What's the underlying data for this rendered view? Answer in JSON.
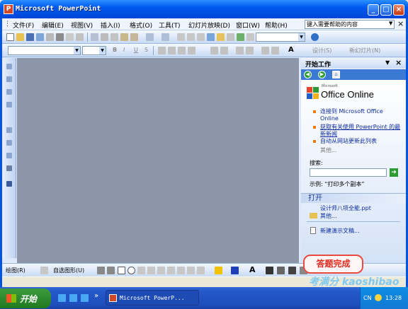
{
  "window": {
    "title": "Microsoft PowerPoint",
    "app_icon": "P",
    "buttons": [
      "minimize",
      "maximize",
      "close"
    ]
  },
  "menu": {
    "items": [
      "文件(F)",
      "编辑(E)",
      "视图(V)",
      "插入(I)",
      "格式(O)",
      "工具(T)",
      "幻灯片放映(D)",
      "窗口(W)",
      "帮助(H)"
    ],
    "help_placeholder": "键入需要帮助的内容",
    "close_doc": "×"
  },
  "format_toolbar": {
    "bold": "B",
    "italic": "I",
    "underline": "U",
    "shadow": "S",
    "font_color": "A",
    "design": "设计(S)",
    "new_slide": "新幻灯片(N)"
  },
  "task_pane": {
    "title": "开始工作",
    "logo_small": "Microsoft",
    "logo_main": "Office Online",
    "links": [
      "连接到 Microsoft Office Online",
      "获取有关使用 PowerPoint 的最新新闻",
      "自动从网站更新此列表"
    ],
    "more": "其他...",
    "search_label": "搜索:",
    "search_value": "",
    "example": "示例: “打印多个副本”",
    "open_header": "打开",
    "recent_file": "设计师八项全能.ppt",
    "open_more": "其他...",
    "new_presentation": "新建演示文稿..."
  },
  "draw_toolbar": {
    "draw": "绘图(R)",
    "autoshapes": "自选图形(U)",
    "font_color": "A"
  },
  "taskbar": {
    "start": "开始",
    "task": "Microsoft PowerP...",
    "lang": "CN",
    "clock": "13:28"
  },
  "overlay": {
    "done": "答题完成",
    "watermark": "考满分 kaoshibao"
  }
}
